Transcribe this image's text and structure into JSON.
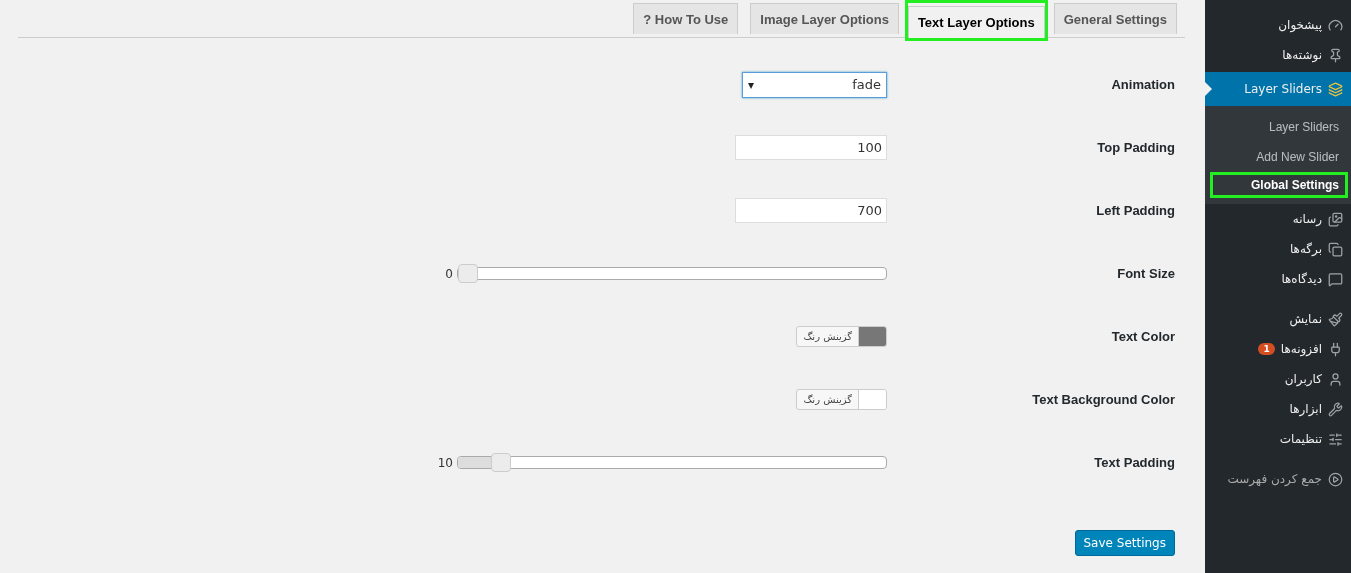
{
  "tabs": [
    {
      "label": "General Settings",
      "selected": false,
      "highlighted": false
    },
    {
      "label": "Text Layer Options",
      "selected": true,
      "highlighted": true
    },
    {
      "label": "Image Layer Options",
      "selected": false,
      "highlighted": false
    },
    {
      "label": "? How To Use",
      "selected": false,
      "highlighted": false
    }
  ],
  "form": {
    "rows": [
      {
        "kind": "select",
        "label": "Animation",
        "value": "fade",
        "caret": "▾"
      },
      {
        "kind": "text",
        "label": "Top Padding",
        "value": "100"
      },
      {
        "kind": "text",
        "label": "Left Padding",
        "value": "700"
      },
      {
        "kind": "slider",
        "label": "Font Size",
        "reading": "0",
        "level": 0
      },
      {
        "kind": "color",
        "label": "Text Color",
        "button": "گزینش رنگ",
        "color": "#777777"
      },
      {
        "kind": "color",
        "label": "Text Background Color",
        "button": "گزینش رنگ",
        "color": "#ffffff"
      },
      {
        "kind": "slider",
        "label": "Text Padding",
        "reading": "10",
        "level": 0.1
      }
    ],
    "save_button": "Save Settings"
  },
  "sidebar": {
    "menu_groups": [
      [
        {
          "label": "پیشخوان",
          "selected": false
        },
        {
          "label": "نوشته‌ها",
          "selected": false
        },
        {
          "label": "Layer Sliders",
          "selected": true,
          "children": [
            {
              "label": "Layer Sliders",
              "selected": false,
              "highlighted": false
            },
            {
              "label": "Add New Slider",
              "selected": false,
              "highlighted": false
            },
            {
              "label": "Global Settings",
              "selected": true,
              "highlighted": true
            }
          ]
        },
        {
          "label": "رسانه",
          "selected": false
        },
        {
          "label": "برگه‌ها",
          "selected": false
        },
        {
          "label": "دیدگاه‌ها",
          "selected": false
        }
      ],
      [
        {
          "label": "نمایش",
          "selected": false
        },
        {
          "label": "افزونه‌ها",
          "selected": false,
          "badge": "1"
        },
        {
          "label": "کاربران",
          "selected": false
        },
        {
          "label": "ابزارها",
          "selected": false
        },
        {
          "label": "تنظیمات",
          "selected": false
        }
      ]
    ],
    "collapse": "جمع کردن فهرست"
  }
}
